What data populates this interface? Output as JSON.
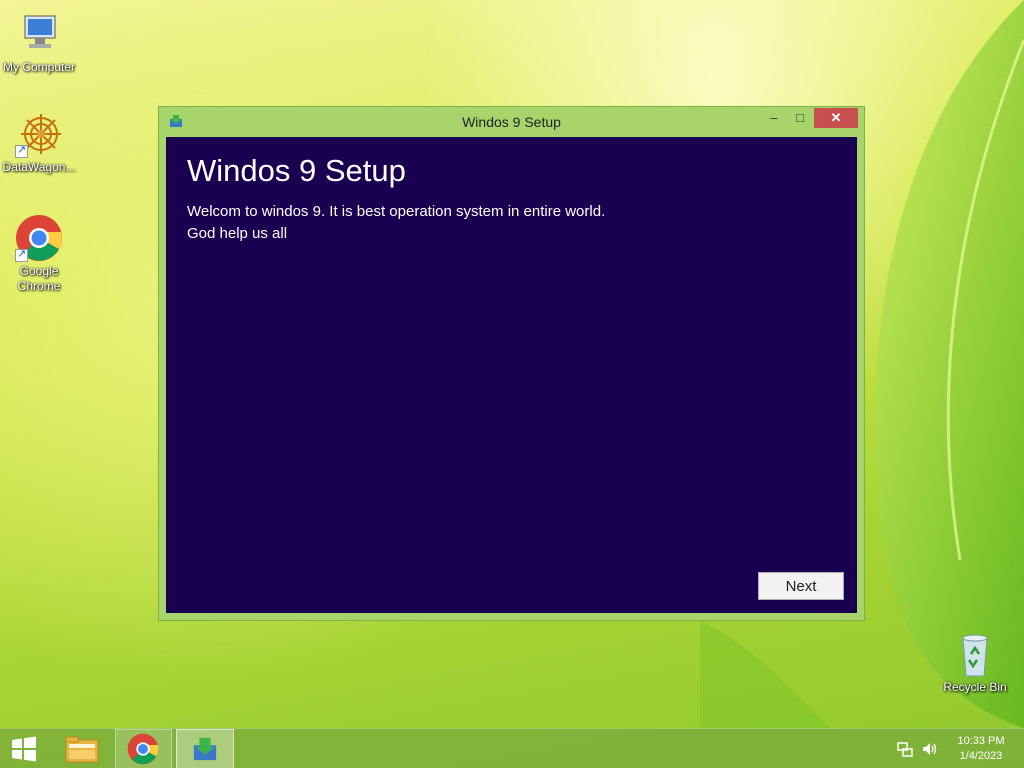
{
  "desktop": {
    "icons": [
      {
        "label": "My Computer",
        "icon": "computer-icon"
      },
      {
        "label": "DataWagon...",
        "icon": "datawagon-icon"
      },
      {
        "label": "Google Chrome",
        "icon": "chrome-icon"
      },
      {
        "label": "Recycle Bin",
        "icon": "recycle-bin-icon"
      }
    ]
  },
  "window": {
    "title": "Windos 9 Setup",
    "controls": {
      "minimize": "–",
      "maximize": "□",
      "close": "✕"
    },
    "heading": "Windos 9 Setup",
    "body_line1": "Welcom to windos 9. It is best operation system in entire world.",
    "body_line2": "God help us all",
    "next_label": "Next",
    "colors": {
      "frame": "#a7d46b",
      "client": "#1a0050",
      "close": "#c7504e"
    }
  },
  "taskbar": {
    "items": [
      "start-icon",
      "file-explorer-icon",
      "chrome-icon",
      "setup-app-icon"
    ],
    "clock": {
      "time": "10:33 PM",
      "date": "1/4/2023"
    }
  }
}
